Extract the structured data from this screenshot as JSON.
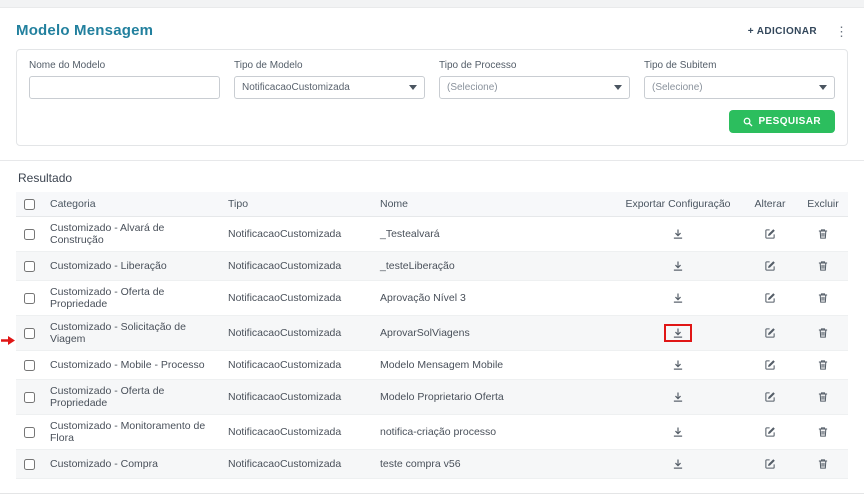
{
  "page": {
    "title": "Modelo Mensagem",
    "add_button": "+ ADICIONAR",
    "more_options": "⋮"
  },
  "filters": {
    "nome": {
      "label": "Nome do Modelo",
      "value": ""
    },
    "tipo_modelo": {
      "label": "Tipo de Modelo",
      "value": "NotificacaoCustomizada"
    },
    "tipo_processo": {
      "label": "Tipo de Processo",
      "value": "(Selecione)"
    },
    "tipo_subitem": {
      "label": "Tipo de Subitem",
      "value": "(Selecione)"
    },
    "search_button": "PESQUISAR"
  },
  "results": {
    "title": "Resultado",
    "columns": [
      "Categoria",
      "Tipo",
      "Nome",
      "Exportar Configuração",
      "Alterar",
      "Excluir"
    ],
    "rows": [
      {
        "categoria": "Customizado - Alvará de Construção",
        "tipo": "NotificacaoCustomizada",
        "nome": "_Testealvará",
        "annotated": false
      },
      {
        "categoria": "Customizado - Liberação",
        "tipo": "NotificacaoCustomizada",
        "nome": "_testeLiberação",
        "annotated": false
      },
      {
        "categoria": "Customizado - Oferta de Propriedade",
        "tipo": "NotificacaoCustomizada",
        "nome": "Aprovação Nível 3",
        "annotated": false
      },
      {
        "categoria": "Customizado - Solicitação de Viagem",
        "tipo": "NotificacaoCustomizada",
        "nome": "AprovarSolViagens",
        "annotated": true
      },
      {
        "categoria": "Customizado - Mobile - Processo",
        "tipo": "NotificacaoCustomizada",
        "nome": "Modelo Mensagem Mobile",
        "annotated": false
      },
      {
        "categoria": "Customizado - Oferta de Propriedade",
        "tipo": "NotificacaoCustomizada",
        "nome": "Modelo Proprietario Oferta",
        "annotated": false
      },
      {
        "categoria": "Customizado - Monitoramento de Flora",
        "tipo": "NotificacaoCustomizada",
        "nome": "notifica-criação processo",
        "annotated": false
      },
      {
        "categoria": "Customizado - Compra",
        "tipo": "NotificacaoCustomizada",
        "nome": "teste compra v56",
        "annotated": false
      }
    ]
  },
  "colors": {
    "title": "#22809e",
    "search_button": "#2cbe5e",
    "annotation": "#e01616",
    "row_alt": "#f6f7f8"
  },
  "icons": {
    "search": "magnifier",
    "download": "download-tray",
    "edit": "pencil-square",
    "delete": "trash",
    "dropdown": "caret-down",
    "more": "vertical-ellipsis"
  }
}
